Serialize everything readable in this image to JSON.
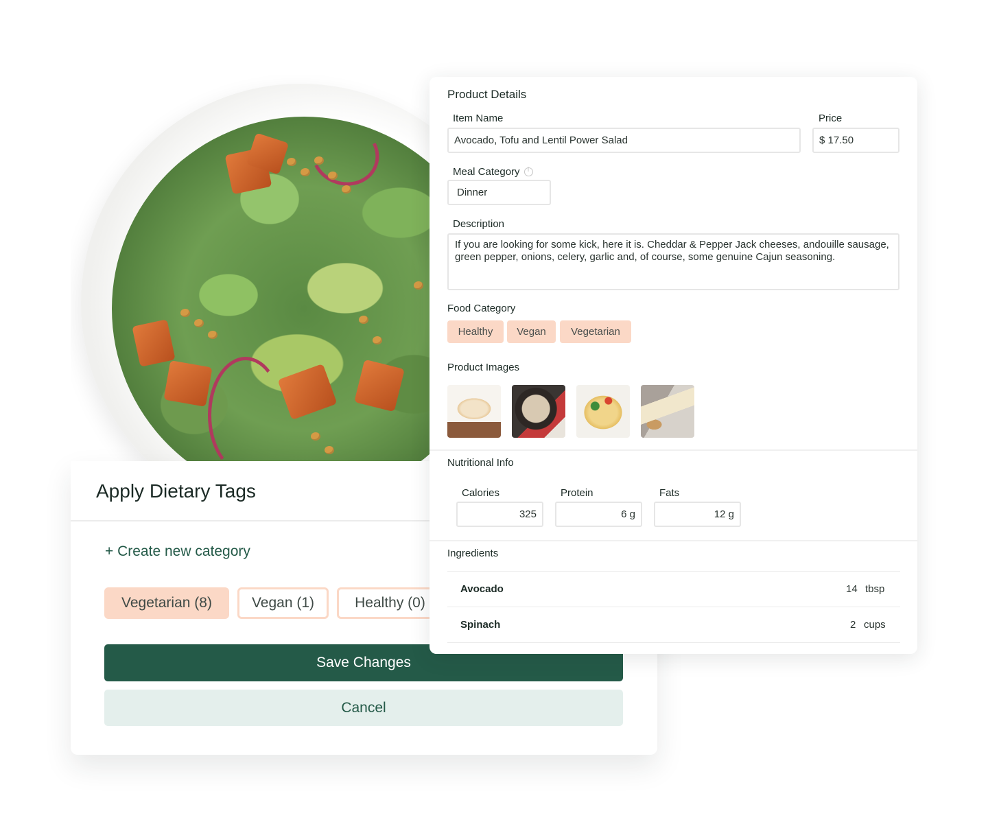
{
  "dietary_card": {
    "title": "Apply Dietary Tags",
    "create_label": "+ Create new category",
    "tags": [
      {
        "label": "Vegetarian (8)",
        "selected": true
      },
      {
        "label": "Vegan (1)",
        "selected": false
      },
      {
        "label": "Healthy (0)",
        "selected": false
      }
    ],
    "save_label": "Save Changes",
    "cancel_label": "Cancel"
  },
  "product": {
    "section_title": "Product Details",
    "item_name_label": "Item Name",
    "item_name_value": "Avocado, Tofu and Lentil Power Salad",
    "price_label": "Price",
    "price_value": "$ 17.50",
    "meal_category_label": "Meal Category",
    "meal_category_value": "Dinner",
    "description_label": "Description",
    "description_value": "If you are looking for some kick, here it is. Cheddar & Pepper Jack cheeses, andouille sausage, green pepper, onions, celery, garlic and, of course, some genuine Cajun seasoning.",
    "food_category_label": "Food Category",
    "food_categories": [
      "Healthy",
      "Vegan",
      "Vegetarian"
    ],
    "images_label": "Product Images",
    "nutrition_label": "Nutritional Info",
    "nutrition": [
      {
        "label": "Calories",
        "value": "325"
      },
      {
        "label": "Protein",
        "value": "6 g"
      },
      {
        "label": "Fats",
        "value": "12 g"
      }
    ],
    "ingredients_label": "Ingredients",
    "ingredients": [
      {
        "name": "Avocado",
        "amount": "14",
        "unit": "tbsp"
      },
      {
        "name": "Spinach",
        "amount": "2",
        "unit": "cups"
      }
    ]
  },
  "colors": {
    "brand_green": "#245a48",
    "tag_peach": "#fbd8c6",
    "cancel_bg": "#e4efec"
  },
  "icons": {
    "meal_category_info": "info-icon"
  }
}
